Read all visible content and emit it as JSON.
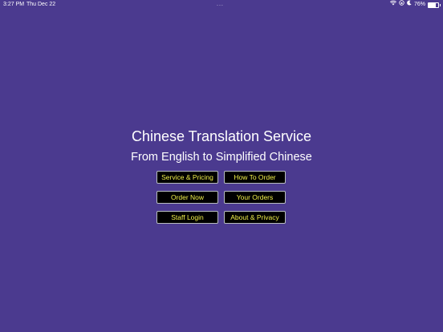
{
  "status_bar": {
    "time": "3:27 PM",
    "date": "Thu Dec 22",
    "dots": "...",
    "battery_percent": "76%",
    "battery_level": 0.76
  },
  "main": {
    "title": "Chinese Translation Service",
    "subtitle": "From English to Simplified Chinese",
    "buttons": {
      "service_pricing": "Service & Pricing",
      "how_to_order": "How To Order",
      "order_now": "Order Now",
      "your_orders": "Your Orders",
      "staff_login": "Staff Login",
      "about_privacy": "About & Privacy"
    }
  },
  "colors": {
    "background": "#4b3a8f",
    "button_bg": "#000000",
    "button_text": "#f2f24a",
    "button_border": "#b8bdbf"
  }
}
